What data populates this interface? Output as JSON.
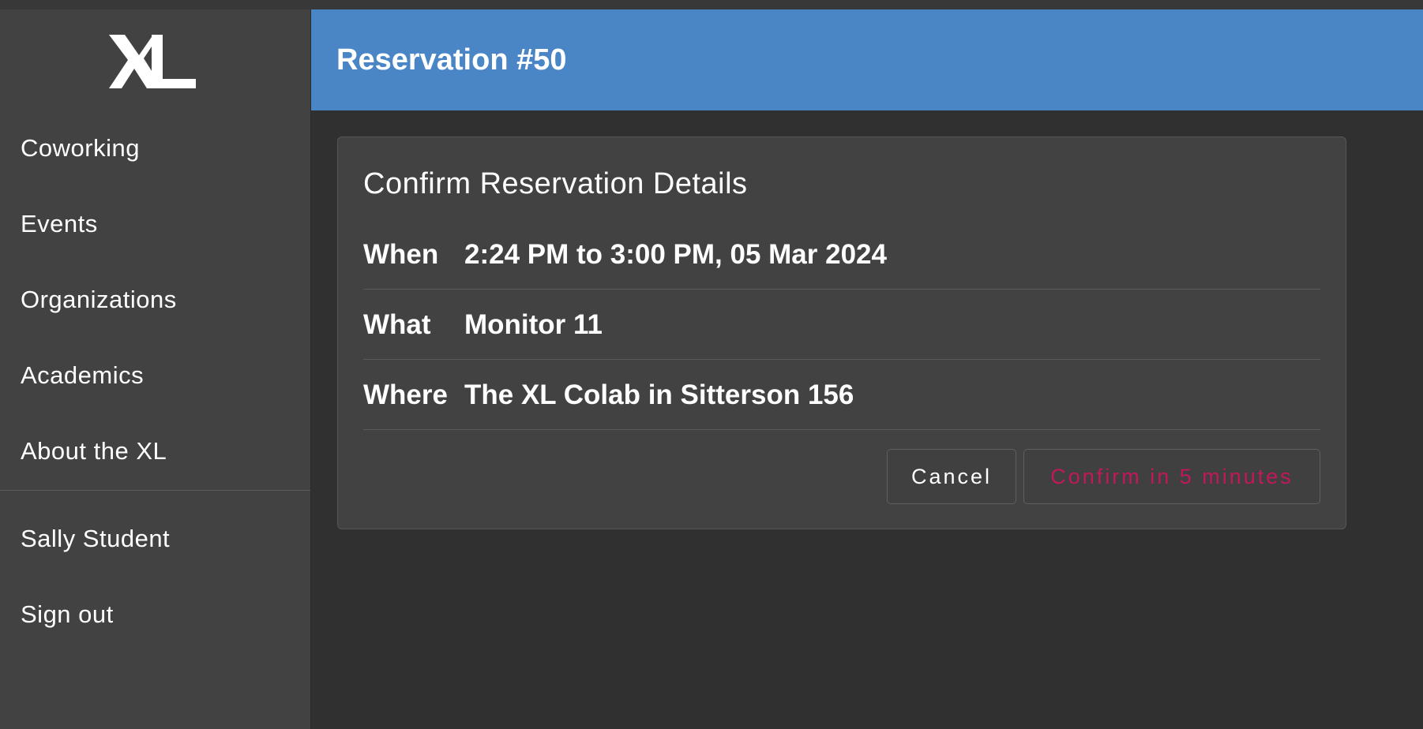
{
  "brand": {
    "logo_text": "XL"
  },
  "sidebar": {
    "items": [
      {
        "label": "Coworking"
      },
      {
        "label": "Events"
      },
      {
        "label": "Organizations"
      },
      {
        "label": "Academics"
      },
      {
        "label": "About the XL"
      }
    ],
    "user_items": [
      {
        "label": "Sally Student"
      },
      {
        "label": "Sign out"
      }
    ]
  },
  "header": {
    "title": "Reservation #50",
    "background_color": "#4a86c6"
  },
  "card": {
    "title": "Confirm Reservation Details",
    "rows": [
      {
        "label": "When",
        "value": "2:24 PM to 3:00 PM, 05 Mar 2024"
      },
      {
        "label": "What",
        "value": "Monitor 11"
      },
      {
        "label": "Where",
        "value": "The XL Colab in Sitterson 156"
      }
    ],
    "cancel_label": "Cancel",
    "confirm_label": "Confirm in 5 minutes",
    "confirm_color": "#c2185b"
  }
}
